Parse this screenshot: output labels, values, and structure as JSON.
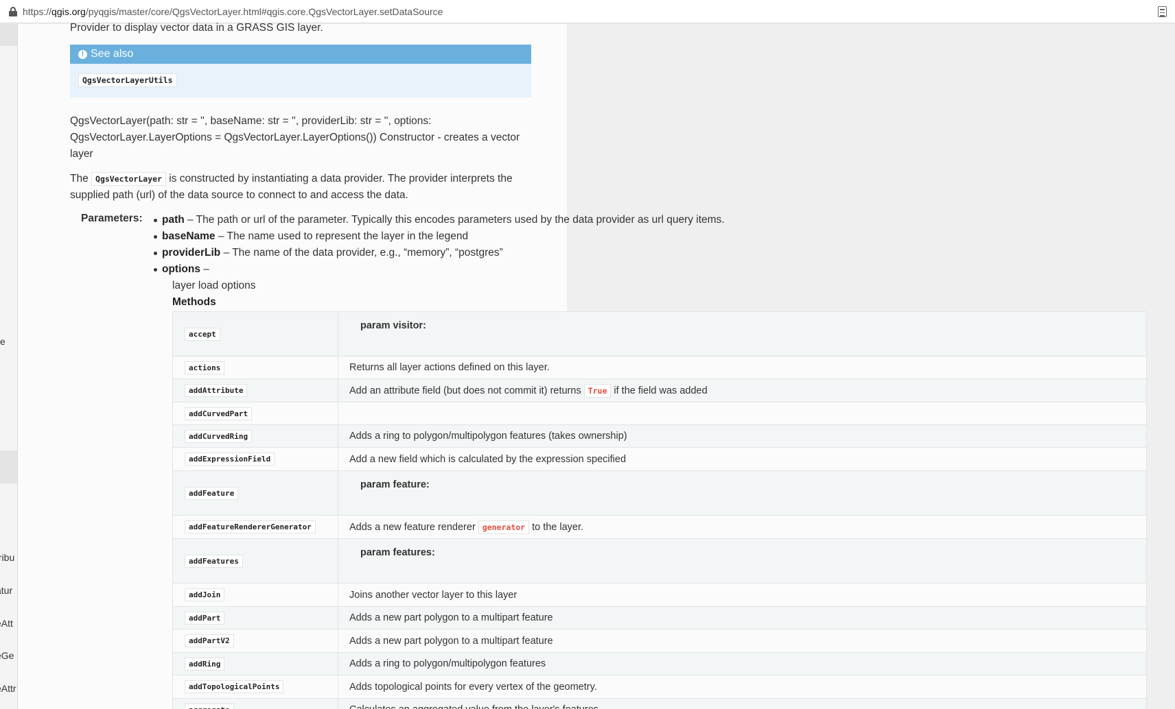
{
  "urlbar": {
    "url_prefix": "https://",
    "url_domain": "qgis.org",
    "url_path": "/pyqgis/master/core/QgsVectorLayer.html#qgis.core.QgsVectorLayer.setDataSource"
  },
  "sidebar": {
    "fragments": [
      "e",
      "tribu",
      "atur",
      "eAtt",
      "eGe",
      "eAttr"
    ]
  },
  "doc": {
    "top_line": "Provider to display vector data in a GRASS GIS layer.",
    "see_also": {
      "heading": "See also",
      "link": "QgsVectorLayerUtils"
    },
    "constructor": {
      "line1": "QgsVectorLayer(path: str = '', baseName: str = '', providerLib: str = '', options:",
      "line2": "QgsVectorLayer.LayerOptions = QgsVectorLayer.LayerOptions()) Constructor - creates a vector",
      "line3": "layer"
    },
    "description": {
      "pre": "The",
      "code": "QgsVectorLayer",
      "post": "is constructed by instantiating a data provider. The provider interprets the",
      "line2": "supplied path (url) of the data source to connect to and access the data."
    },
    "params_label": "Parameters:",
    "params": [
      {
        "name": "path",
        "desc": " – The path or url of the parameter. Typically this encodes parameters used by the data provider as url query items."
      },
      {
        "name": "baseName",
        "desc": " – The name used to represent the layer in the legend"
      },
      {
        "name": "providerLib",
        "desc": " – The name of the data provider, e.g., “memory”, “postgres”"
      },
      {
        "name": "options",
        "desc": " –"
      }
    ],
    "options_desc": "layer load options",
    "methods_label": "Methods"
  },
  "methods": [
    {
      "name": "accept",
      "desc": "param visitor:",
      "type": "param"
    },
    {
      "name": "actions",
      "desc": "Returns all layer actions defined on this layer."
    },
    {
      "name": "addAttribute",
      "desc_pre": "Add an attribute field (but does not commit it) returns",
      "code": "True",
      "desc_post": "if the field was added"
    },
    {
      "name": "addCurvedPart",
      "desc": ""
    },
    {
      "name": "addCurvedRing",
      "desc": "Adds a ring to polygon/multipolygon features (takes ownership)"
    },
    {
      "name": "addExpressionField",
      "desc": "Add a new field which is calculated by the expression specified"
    },
    {
      "name": "addFeature",
      "desc": "param feature:",
      "type": "param"
    },
    {
      "name": "addFeatureRendererGenerator",
      "desc_pre": "Adds a new feature renderer",
      "code": "generator",
      "desc_post": "to the layer."
    },
    {
      "name": "addFeatures",
      "desc": "param features:",
      "type": "param"
    },
    {
      "name": "addJoin",
      "desc": "Joins another vector layer to this layer"
    },
    {
      "name": "addPart",
      "desc": "Adds a new part polygon to a multipart feature"
    },
    {
      "name": "addPartV2",
      "desc": "Adds a new part polygon to a multipart feature"
    },
    {
      "name": "addRing",
      "desc": "Adds a ring to polygon/multipolygon features"
    },
    {
      "name": "addTopologicalPoints",
      "desc": "Adds topological points for every vertex of the geometry."
    },
    {
      "name": "aggregate",
      "desc": "Calculates an aggregated value from the layer's features."
    }
  ]
}
